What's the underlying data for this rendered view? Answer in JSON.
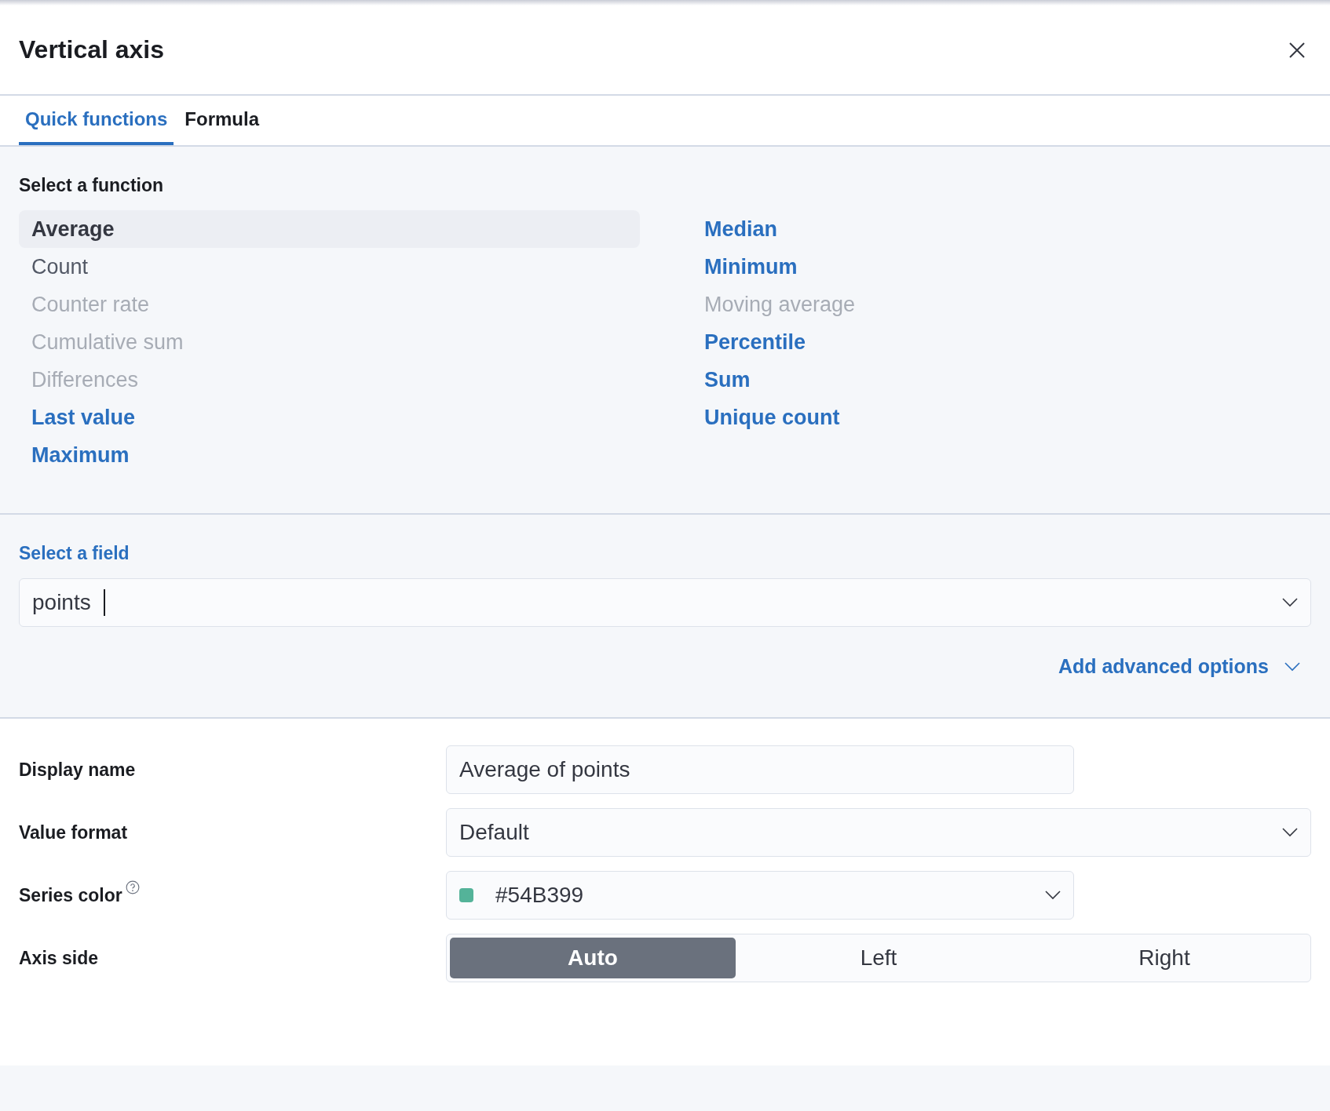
{
  "flyout": {
    "title": "Vertical axis"
  },
  "tabs": [
    {
      "label": "Quick functions",
      "selected": true
    },
    {
      "label": "Formula",
      "selected": false
    }
  ],
  "functions": {
    "label": "Select a function",
    "columns": [
      [
        {
          "label": "Average",
          "kind": "text",
          "selected": true,
          "disabled": false
        },
        {
          "label": "Count",
          "kind": "text",
          "selected": false,
          "disabled": false
        },
        {
          "label": "Counter rate",
          "kind": "text",
          "selected": false,
          "disabled": true
        },
        {
          "label": "Cumulative sum",
          "kind": "text",
          "selected": false,
          "disabled": true
        },
        {
          "label": "Differences",
          "kind": "text",
          "selected": false,
          "disabled": true
        },
        {
          "label": "Last value",
          "kind": "link",
          "selected": false,
          "disabled": false
        },
        {
          "label": "Maximum",
          "kind": "link",
          "selected": false,
          "disabled": false
        }
      ],
      [
        {
          "label": "Median",
          "kind": "link",
          "selected": false,
          "disabled": false
        },
        {
          "label": "Minimum",
          "kind": "link",
          "selected": false,
          "disabled": false
        },
        {
          "label": "Moving average",
          "kind": "text",
          "selected": false,
          "disabled": true
        },
        {
          "label": "Percentile",
          "kind": "link",
          "selected": false,
          "disabled": false
        },
        {
          "label": "Sum",
          "kind": "link",
          "selected": false,
          "disabled": false
        },
        {
          "label": "Unique count",
          "kind": "link",
          "selected": false,
          "disabled": false
        }
      ]
    ]
  },
  "field": {
    "label": "Select a field",
    "value": "points",
    "advanced": "Add advanced options"
  },
  "settings": [
    {
      "label": "Display name",
      "kind": "text",
      "value": "Average of points"
    },
    {
      "label": "Value format",
      "kind": "select",
      "value": "Default"
    },
    {
      "label": "Series color",
      "kind": "color",
      "value": "#54B399",
      "color": "#54b399",
      "help": true
    },
    {
      "label": "Axis side",
      "kind": "buttons",
      "options": [
        {
          "label": "Auto",
          "selected": true
        },
        {
          "label": "Left",
          "selected": false
        },
        {
          "label": "Right",
          "selected": false
        }
      ]
    }
  ]
}
